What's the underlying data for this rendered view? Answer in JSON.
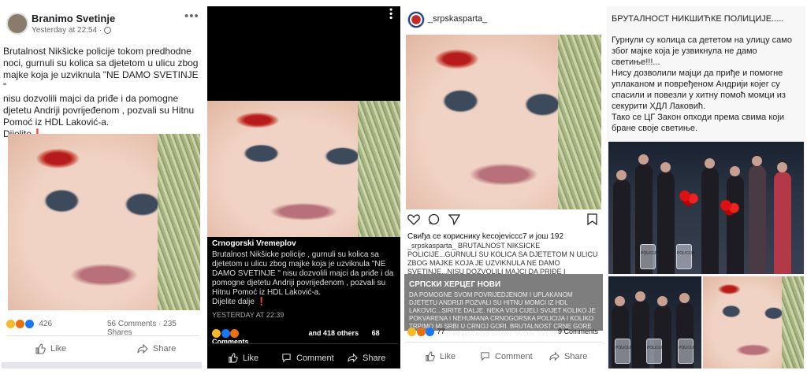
{
  "panel1": {
    "author": "Branimo Svetinje",
    "time": "Yesterday at 22:54 · ",
    "body_lines": [
      "Brutalnost Nikšicke policije tokom predhodne",
      "noci, gurnuli su kolica sa djetetom u ulicu zbog",
      "majke koja je uzviknula \"NE DAMO SVETINJE \"",
      " nisu dozvolili majci da priđe i da pomogne",
      "djetetu Andriji povriјeđenom , pozvali su Hitnu",
      "Pomoć iz HDL Laković-a.",
      "Dijelite❗"
    ],
    "reaction_count": "426",
    "comments": "56 Comments",
    "shares": "· 235 Shares",
    "like": "Like",
    "share": "Share"
  },
  "panel2": {
    "page_name": "Crnogorski Vremeplov",
    "caption": "Brutalnost Nikšicke policije , gurnuli su kolica sa djetetom u ulicu zbog majke koja je uzviknula \"NE DAMO SVETINJE \" nisu dozvolili majci da priđe i da pomogne djetetu Andriji povriјeđenom , pozvali su Hitnu Pomoć iz HDL Laković-a.",
    "share_line": "Dijelite dalje ❗",
    "time": "YESTERDAY AT 22:39",
    "others": "and 418 others",
    "comments": "68 Comments",
    "like": "Like",
    "comment": "Comment",
    "share": "Share"
  },
  "panel3": {
    "username": "_srpskasparta_",
    "liked_by": "Свиђа се кориснику kecojeviccc7 и још 192",
    "caption": "_srpskasparta_ BRUTALNOST NIKSICKE POLICIJE...GURNULI SU KOLICA SA DJETETOM N ULICU ZBOG MAJKE KOJA JE UZVIKNULA NE DAMO SVETINJE...NISU DOZVOLILI MAJCI DA PRIĐE I",
    "overlay_title": "СРПСКИ ХЕРЦЕГ НОВИ",
    "overlay_text": "DA POMOGNE SVOM POVRIJEDJENOM I UPLAKANOM DJETETU ANDRIJI POZVALI SU HITNU MOMCI IZ HDL LAKOVIC...SIRITE DALJE. NEKA VIDI CIJELI SVIJET KOLIKO JE POKVARENA I NEHUMANA CRNOGORSKA POLICIJA I KOLIKO TRPIMO MI SRBI U CRNOJ GORI. BRUTALNOST CRNE GORE PREMA GRADJANIMA KOJI BRANE SVOJE SVETINJE!",
    "reactions": "77",
    "comments": "9 Comments",
    "like": "Like",
    "comment": "Comment",
    "share": "Share"
  },
  "panel4": {
    "title": "БРУТАЛНОСТ НИКШИЋКЕ ПОЛИЦИЈЕ.....",
    "body_lines": [
      "Гурнули су колица са дететом на улицу само",
      "због мајке која је узвикнула не дамо",
      "светиње!!!...",
      "Нису дозволили мајци да приђе и помогне",
      "уплаканом и повређеном Андрији којег су",
      "спасили и повезли у хитну помоћ момци из",
      "секурити ХДЛ Лаковић.",
      "Тако се ЦГ Закон опходи према свима који",
      "бране своје светиње."
    ]
  },
  "colors": {
    "fb_blue": "#1877f2",
    "fb_gray": "#65676b",
    "heart_red": "#e0245e"
  }
}
